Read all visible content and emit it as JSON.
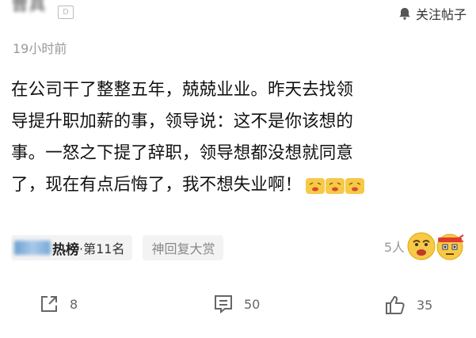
{
  "header": {
    "username": "曹真",
    "follow_label": "关注帖子",
    "follow_icon": "bell-icon"
  },
  "post": {
    "time": "19小时前",
    "lines": [
      "在公司干了整整五年，兢兢业业。昨天去找领",
      "导提升职加薪的事，领导说：这不是你该想的",
      "事。一怒之下提了辞职，领导想都没想就同意",
      "了，现在有点后悔了，我不想失业啊！"
    ]
  },
  "tags": {
    "hot_name": "热榜",
    "hot_rank": "·第11名",
    "award": "神回复大赏"
  },
  "reactions": {
    "count": "5人"
  },
  "actions": {
    "share_count": "8",
    "comment_count": "50",
    "like_count": "35"
  },
  "colors": {
    "text": "#111111",
    "muted": "#999999",
    "tag_bg": "#f3f3f3",
    "emoji_yellow": "#f7c948"
  }
}
